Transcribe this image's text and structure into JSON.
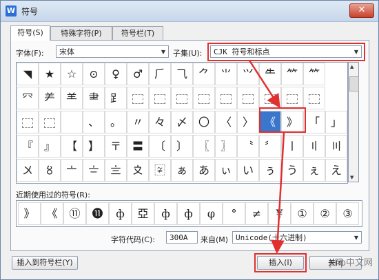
{
  "window": {
    "title": "符号",
    "icon_letter": "W",
    "close_glyph": "✕"
  },
  "tabs": [
    {
      "label": "符号(S)",
      "active": true
    },
    {
      "label": "特殊字符(P)",
      "active": false
    },
    {
      "label": "符号栏(T)",
      "active": false
    }
  ],
  "font": {
    "label": "字体(F):",
    "value": "宋体"
  },
  "subset": {
    "label": "子集(U):",
    "value": "CJK 符号和标点"
  },
  "grid_rows": [
    [
      "◥",
      "★",
      "☆",
      "⊙",
      "♀",
      "♂",
      "⺁",
      "⺄",
      "⺈",
      "⺌",
      "⺍",
      "⺧",
      "⺮",
      "⺮"
    ],
    [
      "⺳",
      "⺶",
      "⺷",
      "⺻",
      "⻊",
      "⬚",
      "⬚",
      "⬚",
      "⬚",
      "⬚",
      "⬚",
      "⬚",
      "⬚",
      "⬚"
    ],
    [
      "⬚",
      "⬚",
      "",
      "、",
      "。",
      "〃",
      "々",
      "〆",
      "〇",
      "〈",
      "〉",
      "《",
      "》",
      "「",
      "」"
    ],
    [
      "『",
      "』",
      "【",
      "】",
      "〒",
      "〓",
      "〔",
      "〕",
      "〖",
      "〗",
      "〝",
      "〞",
      "〡",
      "〢",
      "〣"
    ],
    [
      "〤",
      "〥",
      "〦",
      "〧",
      "〨",
      "〩",
      "〾",
      "ぁ",
      "あ",
      "ぃ",
      "い",
      "ぅ",
      "う",
      "ぇ",
      "え"
    ]
  ],
  "selected_symbol": "《",
  "recent": {
    "label": "近期使用过的符号(R):",
    "items": [
      "》",
      "《",
      "⑪",
      "⓫",
      "ф",
      "亞",
      "ф",
      "ф",
      "φ",
      "°",
      "≠",
      "¥",
      "①",
      "②",
      "③"
    ]
  },
  "char_code": {
    "label": "字符代码(C):",
    "value": "300A"
  },
  "from": {
    "label": "来自(M)",
    "value": "Unicode(十六进制)"
  },
  "buttons": {
    "insert_to_bar": "插入到符号栏(Y)",
    "insert": "插入(I)",
    "close": "关闭"
  },
  "watermark": "php中文网",
  "colors": {
    "highlight": "#e03030",
    "selection": "#3a76cc"
  }
}
